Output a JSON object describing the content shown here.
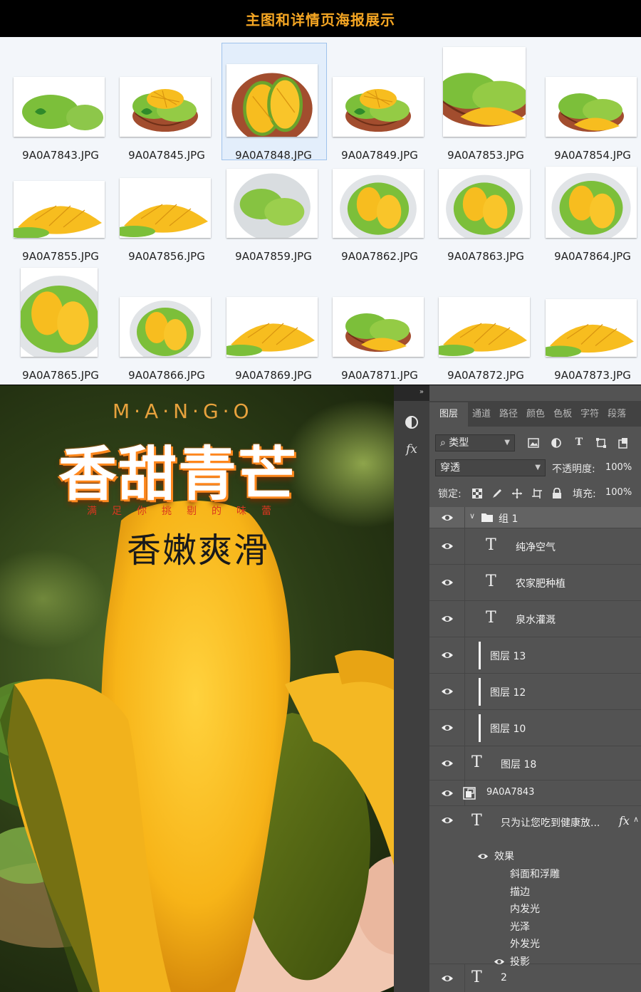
{
  "header": {
    "title": "主图和详情页海报展示"
  },
  "files": [
    {
      "name": "9A0A7843.JPG",
      "variant": "whole"
    },
    {
      "name": "9A0A7845.JPG",
      "variant": "basket"
    },
    {
      "name": "9A0A7848.JPG",
      "variant": "halves",
      "selected": true
    },
    {
      "name": "9A0A7849.JPG",
      "variant": "basket"
    },
    {
      "name": "9A0A7853.JPG",
      "variant": "basket-slice"
    },
    {
      "name": "9A0A7854.JPG",
      "variant": "basket-slice"
    },
    {
      "name": "9A0A7855.JPG",
      "variant": "slice"
    },
    {
      "name": "9A0A7856.JPG",
      "variant": "slice"
    },
    {
      "name": "9A0A7859.JPG",
      "variant": "bowl-green"
    },
    {
      "name": "9A0A7862.JPG",
      "variant": "bowl-halves"
    },
    {
      "name": "9A0A7863.JPG",
      "variant": "bowl-halves"
    },
    {
      "name": "9A0A7864.JPG",
      "variant": "bowl-halves"
    },
    {
      "name": "9A0A7865.JPG",
      "variant": "bowl-halves"
    },
    {
      "name": "9A0A7866.JPG",
      "variant": "bowl-halves"
    },
    {
      "name": "9A0A7869.JPG",
      "variant": "slice"
    },
    {
      "name": "9A0A7871.JPG",
      "variant": "basket-slice"
    },
    {
      "name": "9A0A7872.JPG",
      "variant": "slice"
    },
    {
      "name": "9A0A7873.JPG",
      "variant": "slice"
    }
  ],
  "poster": {
    "brand_letters": "M·A·N·G·O",
    "title": "香甜青芒",
    "slogan": "满足你挑剔的味蕾",
    "subtitle": "香嫩爽滑"
  },
  "ps": {
    "collapse_label": "»",
    "tabs": [
      "图层",
      "通道",
      "路径",
      "颜色",
      "色板",
      "字符",
      "段落"
    ],
    "filter_type": "类型",
    "blend_mode": "穿透",
    "opacity_label": "不透明度:",
    "opacity_value": "100%",
    "lock_label": "锁定:",
    "fill_label": "填充:",
    "fill_value": "100%",
    "layers": {
      "group_name": "组 1",
      "text1": "纯净空气",
      "text2": "农家肥种植",
      "text3": "泉水灌溉",
      "layer13": "图层 13",
      "layer12": "图层 12",
      "layer10": "图层 10",
      "layer18": "图层 18",
      "smart": "9A0A7843",
      "textfx": "只为让您吃到健康放...",
      "effects_label": "效果",
      "effects": [
        "斜面和浮雕",
        "描边",
        "内发光",
        "光泽",
        "外发光",
        "投影"
      ],
      "text_last": "2"
    }
  },
  "colors": {
    "accent": "#f5a623",
    "panel": "#535353",
    "title_glow": "#ff8a1f"
  }
}
